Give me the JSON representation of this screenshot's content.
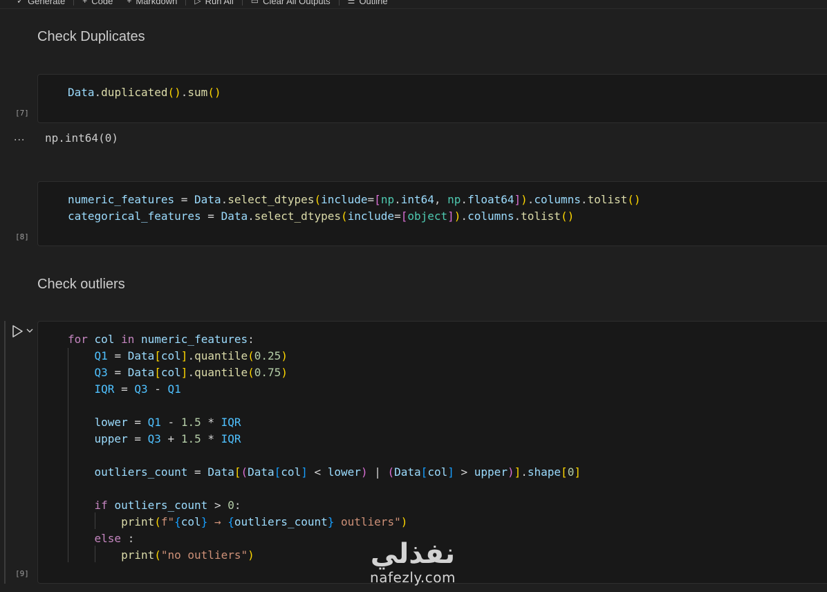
{
  "toolbar": {
    "items": [
      {
        "icon": "sparkle-icon",
        "label": "Generate"
      },
      {
        "icon": "plus-icon",
        "label": "Code"
      },
      {
        "icon": "plus-icon",
        "label": "Markdown"
      },
      {
        "icon": "run-all-icon",
        "label": "Run All"
      },
      {
        "icon": "clear-outputs-icon",
        "label": "Clear All Outputs"
      },
      {
        "icon": "outline-icon",
        "label": "Outline"
      }
    ]
  },
  "cells": {
    "md1": "Check Duplicates",
    "cell7": {
      "exec": "[7]",
      "output_dots": "...",
      "output": "np.int64(0)"
    },
    "cell8": {
      "exec": "[8]"
    },
    "md2": "Check outliers",
    "cell9": {
      "exec": "[9]"
    }
  },
  "code": {
    "cell7": [
      "Data.duplicated().sum()"
    ],
    "cell8": [
      "numeric_features = Data.select_dtypes(include=[np.int64, np.float64]).columns.tolist()",
      "categorical_features = Data.select_dtypes(include=[object]).columns.tolist()"
    ],
    "cell9": [
      "for col in numeric_features:",
      "    Q1 = Data[col].quantile(0.25)",
      "    Q3 = Data[col].quantile(0.75)",
      "    IQR = Q3 - Q1",
      "",
      "    lower = Q1 - 1.5 * IQR",
      "    upper = Q3 + 1.5 * IQR",
      "",
      "    outliers_count = Data[(Data[col] < lower) | (Data[col] > upper)].shape[0]",
      "",
      "    if outliers_count > 0:",
      "        print(f\"{col} → {outliers_count} outliers\")",
      "    else :",
      "        print(\"no outliers\")"
    ]
  },
  "watermark": {
    "arabic": "نفذلي",
    "latin": "nafezly.com"
  },
  "colors": {
    "background": "#1f1f1f",
    "cell_bg": "#181818",
    "keyword": "#c586c0",
    "variable": "#9cdcfe",
    "function": "#dcdcaa",
    "number": "#b5cea8",
    "string": "#ce9178"
  }
}
